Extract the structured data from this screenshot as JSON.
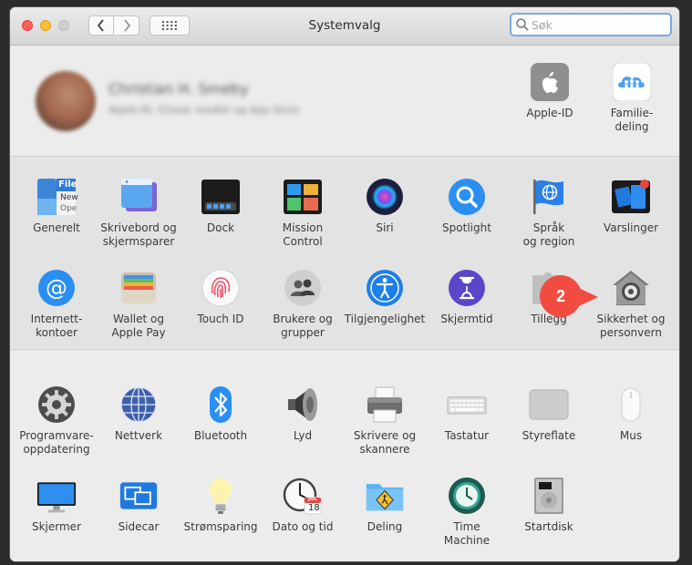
{
  "window": {
    "title": "Systemvalg"
  },
  "search": {
    "placeholder": "Søk",
    "value": ""
  },
  "account": {
    "name": "Christian H. Smeby",
    "subtitle": "Apple-ID, iCloud, medier og App Store"
  },
  "account_panes": [
    {
      "id": "apple-id",
      "label": "Apple-ID",
      "icon": "apple-logo-icon"
    },
    {
      "id": "family",
      "label": "Familie-\ndeling",
      "icon": "family-sharing-icon"
    }
  ],
  "personal_panes": [
    {
      "id": "general",
      "label": "Generelt",
      "icon": "general-icon"
    },
    {
      "id": "desktop",
      "label": "Skrivebord og\nskjermsparer",
      "icon": "desktop-icon"
    },
    {
      "id": "dock",
      "label": "Dock",
      "icon": "dock-icon"
    },
    {
      "id": "mission",
      "label": "Mission\nControl",
      "icon": "mission-control-icon"
    },
    {
      "id": "siri",
      "label": "Siri",
      "icon": "siri-icon"
    },
    {
      "id": "spotlight",
      "label": "Spotlight",
      "icon": "spotlight-icon"
    },
    {
      "id": "language",
      "label": "Språk\nog region",
      "icon": "flag-globe-icon"
    },
    {
      "id": "notifications",
      "label": "Varslinger",
      "icon": "notifications-icon"
    },
    {
      "id": "internet",
      "label": "Internett-\nkontoer",
      "icon": "at-sign-icon"
    },
    {
      "id": "wallet",
      "label": "Wallet og\nApple Pay",
      "icon": "wallet-icon"
    },
    {
      "id": "touchid",
      "label": "Touch ID",
      "icon": "fingerprint-icon"
    },
    {
      "id": "users",
      "label": "Brukere og\ngrupper",
      "icon": "users-icon"
    },
    {
      "id": "accessibility",
      "label": "Tilgjengelighet",
      "icon": "accessibility-icon"
    },
    {
      "id": "screentime",
      "label": "Skjermtid",
      "icon": "hourglass-icon"
    },
    {
      "id": "extensions",
      "label": "Tillegg",
      "icon": "puzzle-piece-icon"
    },
    {
      "id": "security",
      "label": "Sikkerhet og\npersonvern",
      "icon": "security-house-icon"
    }
  ],
  "hardware_panes": [
    {
      "id": "software-update",
      "label": "Programvare-\noppdatering",
      "icon": "gear-icon"
    },
    {
      "id": "network",
      "label": "Nettverk",
      "icon": "network-globe-icon"
    },
    {
      "id": "bluetooth",
      "label": "Bluetooth",
      "icon": "bluetooth-icon"
    },
    {
      "id": "sound",
      "label": "Lyd",
      "icon": "speaker-icon"
    },
    {
      "id": "printers",
      "label": "Skrivere og\nskannere",
      "icon": "printer-icon"
    },
    {
      "id": "keyboard",
      "label": "Tastatur",
      "icon": "keyboard-icon"
    },
    {
      "id": "trackpad",
      "label": "Styreflate",
      "icon": "trackpad-icon"
    },
    {
      "id": "mouse",
      "label": "Mus",
      "icon": "mouse-icon"
    },
    {
      "id": "displays",
      "label": "Skjermer",
      "icon": "display-icon"
    },
    {
      "id": "sidecar",
      "label": "Sidecar",
      "icon": "sidecar-icon"
    },
    {
      "id": "energy",
      "label": "Strømsparing",
      "icon": "lightbulb-icon"
    },
    {
      "id": "datetime",
      "label": "Dato og tid",
      "icon": "clock-calendar-icon"
    },
    {
      "id": "sharing",
      "label": "Deling",
      "icon": "sharing-folder-icon"
    },
    {
      "id": "timemachine",
      "label": "Time\nMachine",
      "icon": "time-machine-icon"
    },
    {
      "id": "startup",
      "label": "Startdisk",
      "icon": "hard-disk-icon"
    }
  ],
  "callout": {
    "number": "2"
  },
  "calendar_icon": {
    "month": "JUL",
    "day": "18"
  },
  "general_icon": {
    "text1": "File",
    "text2": "New",
    "text3": "Ope"
  }
}
